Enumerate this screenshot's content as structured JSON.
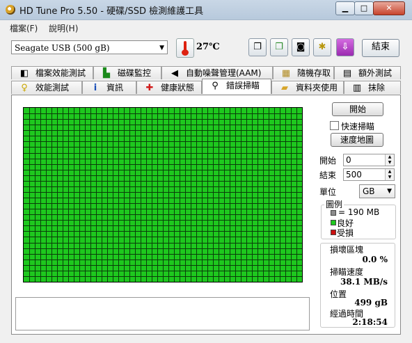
{
  "window": {
    "title": "HD Tune Pro 5.50 - 硬碟/SSD 檢測維護工具",
    "min_glyph": "▁",
    "max_glyph": "□",
    "close_glyph": "✕"
  },
  "menu": {
    "items": [
      "檔案(F)",
      "說明(H)"
    ]
  },
  "toolbar": {
    "drive": "Seagate USB (500 gB)",
    "temperature": "27℃",
    "exit_label": "結束",
    "icons": [
      "copy-info-icon",
      "copy-screen-icon",
      "camera-icon",
      "options-icon",
      "save-icon"
    ]
  },
  "tabs_top": [
    {
      "label": "檔案效能測試",
      "icon": "file-benchmark-icon"
    },
    {
      "label": "磁碟監控",
      "icon": "disk-monitor-icon"
    },
    {
      "label": "自動噪聲管理(AAM)",
      "icon": "speaker-icon"
    },
    {
      "label": "隨機存取",
      "icon": "random-access-icon"
    },
    {
      "label": "額外測試",
      "icon": "extra-tests-icon"
    }
  ],
  "tabs_bottom": [
    {
      "label": "效能測試",
      "icon": "lightbulb-icon"
    },
    {
      "label": "資訊",
      "icon": "info-icon"
    },
    {
      "label": "健康狀態",
      "icon": "health-cross-icon"
    },
    {
      "label": "錯誤掃瞄",
      "icon": "magnifier-icon",
      "active": true
    },
    {
      "label": "資料夾使用",
      "icon": "folder-icon"
    },
    {
      "label": "抹除",
      "icon": "trash-icon"
    }
  ],
  "scan": {
    "start_label": "開始",
    "quick_scan_label": "快速掃瞄",
    "quick_scan_checked": false,
    "speed_map_label": "速度地圖",
    "start_field_label": "開始",
    "start_value": "0",
    "end_field_label": "結束",
    "end_value": "500",
    "unit_label": "單位",
    "unit_value": "GB",
    "grid_columns": 50,
    "grid_rows": 31,
    "block_color": "#1ec81e",
    "damaged_blocks": 0
  },
  "legend": {
    "title": "圖例",
    "items": [
      {
        "label": "= 190 MB",
        "color": "#8c8c8c"
      },
      {
        "label": "良好",
        "color": "#1ec81e"
      },
      {
        "label": "受損",
        "color": "#cc1111"
      }
    ]
  },
  "stats": {
    "damaged_label": "損壞區塊",
    "damaged_value": "0.0 %",
    "speed_label": "掃瞄速度",
    "speed_value": "38.1 MB/s",
    "position_label": "位置",
    "position_value": "499 gB",
    "elapsed_label": "經過時間",
    "elapsed_value": "2:18:54"
  }
}
